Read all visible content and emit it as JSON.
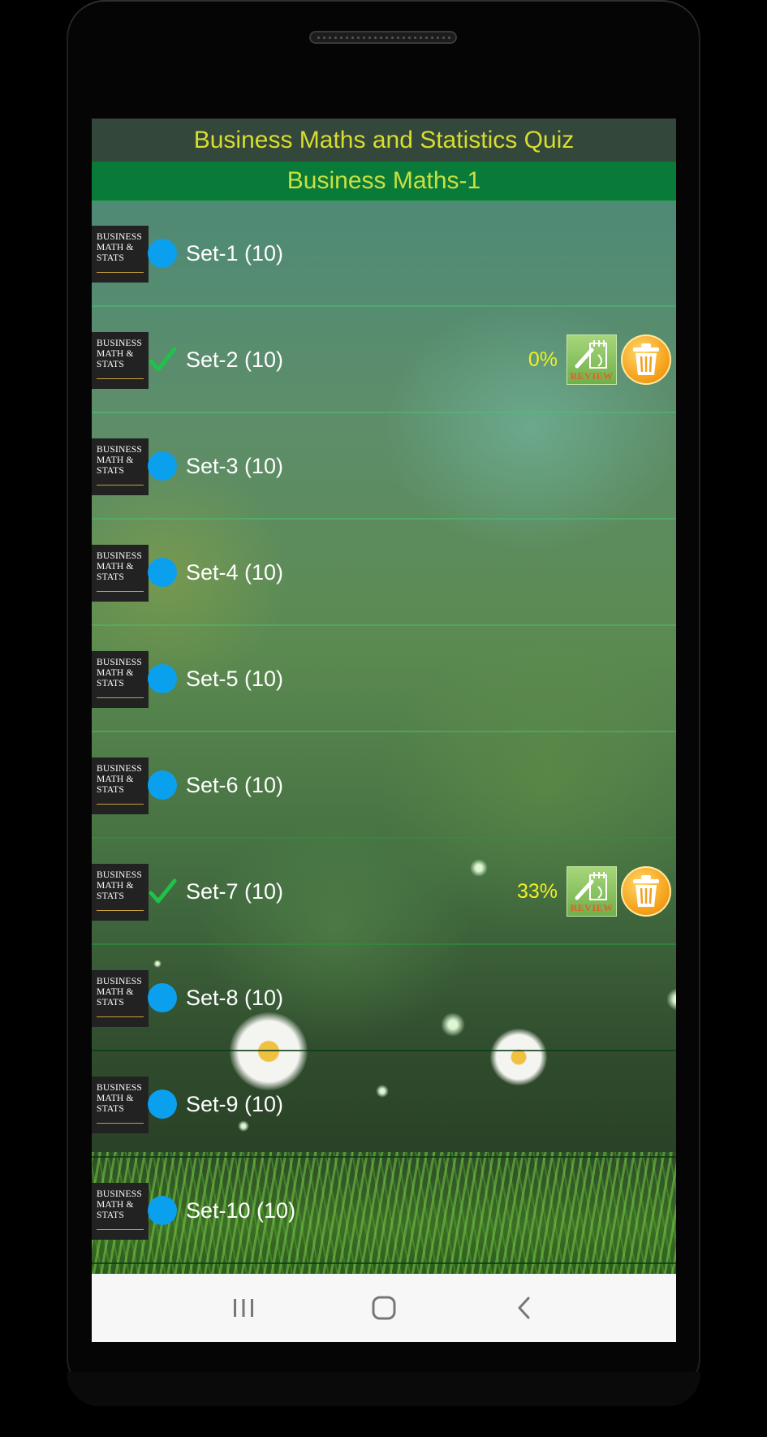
{
  "app": {
    "title": "Business Maths and Statistics Quiz",
    "subtitle": "Business Maths-1"
  },
  "thumbnail": {
    "lines": [
      "BUSINESS",
      "MATH &",
      "STATS"
    ]
  },
  "sets": [
    {
      "label": "Set-1 (10)",
      "status": "not-attempted",
      "score": null
    },
    {
      "label": "Set-2 (10)",
      "status": "completed",
      "score": "0%"
    },
    {
      "label": "Set-3 (10)",
      "status": "not-attempted",
      "score": null
    },
    {
      "label": "Set-4 (10)",
      "status": "not-attempted",
      "score": null
    },
    {
      "label": "Set-5 (10)",
      "status": "not-attempted",
      "score": null
    },
    {
      "label": "Set-6 (10)",
      "status": "not-attempted",
      "score": null
    },
    {
      "label": "Set-7 (10)",
      "status": "completed",
      "score": "33%"
    },
    {
      "label": "Set-8 (10)",
      "status": "not-attempted",
      "score": null
    },
    {
      "label": "Set-9 (10)",
      "status": "not-attempted",
      "score": null
    },
    {
      "label": "Set-10 (10)",
      "status": "not-attempted",
      "score": null
    }
  ],
  "review_button": {
    "label": "REVIEW",
    "icon": "review-icon"
  },
  "delete_button": {
    "icon": "trash-icon"
  },
  "navigation": {
    "recents_icon": "recents-icon",
    "home_icon": "home-icon",
    "back_icon": "back-icon"
  },
  "colors": {
    "title_bar": "#33473a",
    "title_text": "#d8dc30",
    "subtitle_bar": "#0a7a38",
    "subtitle_text": "#c8e040",
    "status_dot": "#0aa0ee",
    "checkmark": "#1fc24a",
    "score_text": "#f0f020"
  }
}
